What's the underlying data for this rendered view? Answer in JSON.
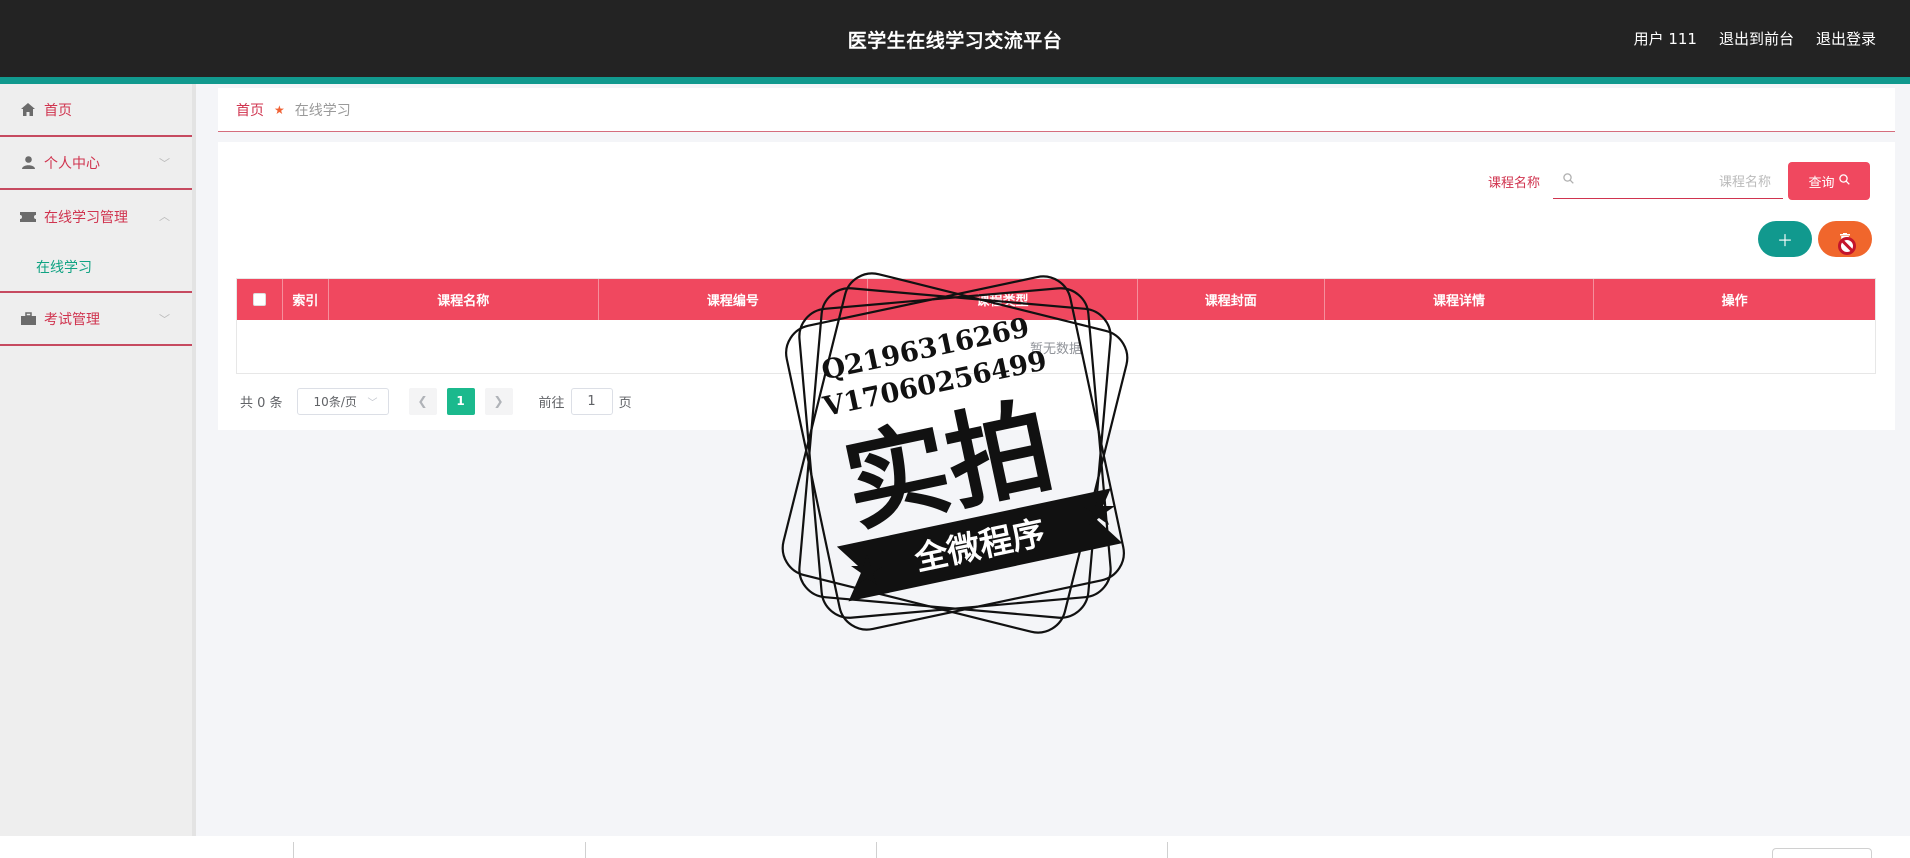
{
  "header": {
    "title": "医学生在线学习交流平台",
    "user": "用户 111",
    "to_front": "退出到前台",
    "logout": "退出登录"
  },
  "sidebar": {
    "items": [
      {
        "label": "首页",
        "icon": "home-icon"
      },
      {
        "label": "个人中心",
        "icon": "user-icon"
      },
      {
        "label": "在线学习管理",
        "icon": "ticket-icon",
        "expanded": true,
        "children": [
          {
            "label": "在线学习"
          }
        ]
      },
      {
        "label": "考试管理",
        "icon": "briefcase-icon"
      }
    ]
  },
  "breadcrumb": {
    "home": "首页",
    "current": "在线学习"
  },
  "search": {
    "label": "课程名称",
    "placeholder": "课程名称",
    "button": "查询"
  },
  "table": {
    "columns": [
      "索引",
      "课程名称",
      "课程编号",
      "课程类型",
      "课程封面",
      "课程详情",
      "操作"
    ],
    "empty_text": "暂无数据"
  },
  "pagination": {
    "total": "共 0 条",
    "page_size": "10条/页",
    "current_page": "1",
    "goto_label": "前往",
    "goto_value": "1",
    "page_suffix": "页"
  },
  "watermark": {
    "qq": "Q2196316269",
    "wechat": "V17060256499",
    "big": "实拍",
    "banner": "全微程序"
  },
  "colors": {
    "header_bg": "#232323",
    "accent_teal": "#11998e",
    "primary_red": "#f0485f",
    "delete_orange": "#f0662c",
    "page_active": "#1bb98d"
  }
}
